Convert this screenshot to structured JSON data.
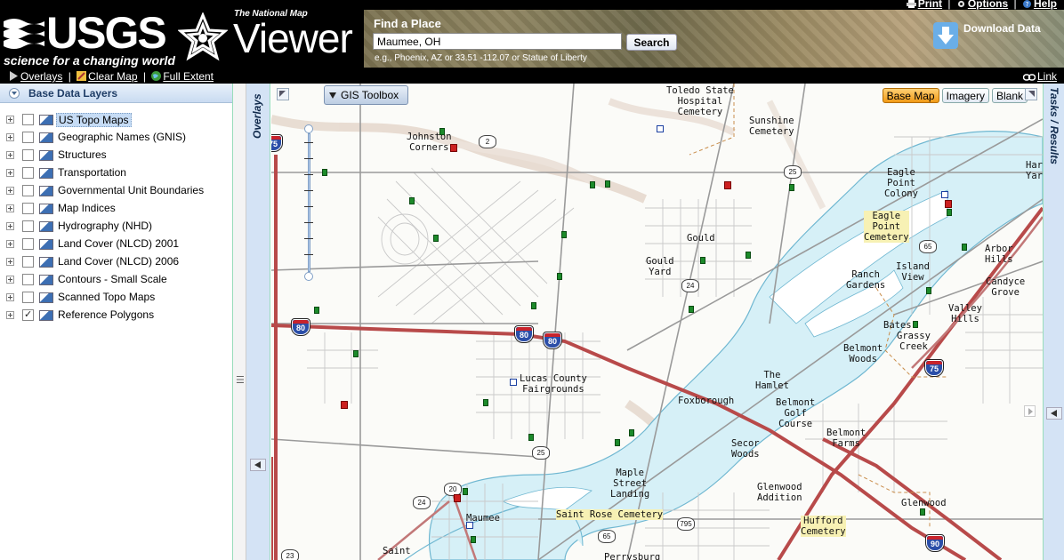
{
  "header": {
    "usgs_word": "USGS",
    "usgs_tagline": "science for a changing world",
    "viewer_subtitle": "The National Map",
    "viewer_title": "Viewer",
    "top_links": {
      "print": "Print",
      "options": "Options",
      "help": "Help"
    }
  },
  "find_place": {
    "title": "Find a Place",
    "value": "Maumee, OH",
    "search_label": "Search",
    "hint": "e.g., Phoenix, AZ or 33.51 -112.07 or Statue of Liberty"
  },
  "download": {
    "label": "Download Data"
  },
  "toolbar": {
    "overlays": "Overlays",
    "clear_map": "Clear Map",
    "full_extent": "Full Extent",
    "link": "Link"
  },
  "layers": {
    "title": "Base Data Layers",
    "items": [
      {
        "label": "US Topo Maps",
        "checked": false,
        "selected": true
      },
      {
        "label": "Geographic Names (GNIS)",
        "checked": false
      },
      {
        "label": "Structures",
        "checked": false
      },
      {
        "label": "Transportation",
        "checked": false
      },
      {
        "label": "Governmental Unit Boundaries",
        "checked": false
      },
      {
        "label": "Map Indices",
        "checked": false
      },
      {
        "label": "Hydrography (NHD)",
        "checked": false
      },
      {
        "label": "Land Cover (NLCD) 2001",
        "checked": false
      },
      {
        "label": "Land Cover (NLCD) 2006",
        "checked": false
      },
      {
        "label": "Contours - Small Scale",
        "checked": false
      },
      {
        "label": "Scanned Topo Maps",
        "checked": false
      },
      {
        "label": "Reference Polygons",
        "checked": true
      }
    ]
  },
  "side_tabs": {
    "overlays": "Overlays",
    "tasks": "Tasks / Results"
  },
  "map": {
    "gis_toolbox": "GIS Toolbox",
    "basemap_buttons": [
      "Base Map",
      "Imagery",
      "Blank"
    ],
    "active_basemap": "Base Map",
    "labels": {
      "johnston": "Johnston\nCorners",
      "toledo": "Toledo State\nHospital\nCemetery",
      "sunshine": "Sunshine\nCemetery",
      "eagle_colony": "Eagle\nPoint\nColony",
      "eagle_cem": "Eagle\nPoint\nCemetery",
      "harbor": "Har\nYar",
      "gould": "Gould",
      "gould_yard": "Gould\nYard",
      "arbor": "Arbor\nHills",
      "island_view": "Island\nView",
      "ranch": "Ranch\nGardens",
      "candyce": "Candyce\nGrove",
      "valley": "Valley\nHills",
      "bates": "Bates",
      "grassy": "Grassy\nCreek",
      "belmont_woods": "Belmont\nWoods",
      "lucas": "Lucas County\nFairgrounds",
      "hamlet": "The\nHamlet",
      "foxborough": "Foxborough",
      "belmont_golf": "Belmont\nGolf\nCourse",
      "belmont_farms": "Belmont\nFarms",
      "secor": "Secor\nWoods",
      "maple": "Maple\nStreet\nLanding",
      "glenwood_add": "Glenwood\nAddition",
      "saint_rose": "Saint Rose Cemetery",
      "glenwood": "Glenwood",
      "hufford": "Hufford\nCemetery",
      "maumee": "Maumee",
      "saint": "Saint",
      "perrysburg": "Perrysburg"
    },
    "shields": {
      "i75_top": "75",
      "r2": "2",
      "r25a": "25",
      "r65": "65",
      "r24": "24",
      "i80a": "80",
      "i80b": "80",
      "i80c": "80",
      "i75_mid": "75",
      "r25b": "25",
      "r20": "20",
      "r24b": "24",
      "r795": "795",
      "r65b": "65",
      "r23": "23",
      "i90": "90"
    }
  }
}
